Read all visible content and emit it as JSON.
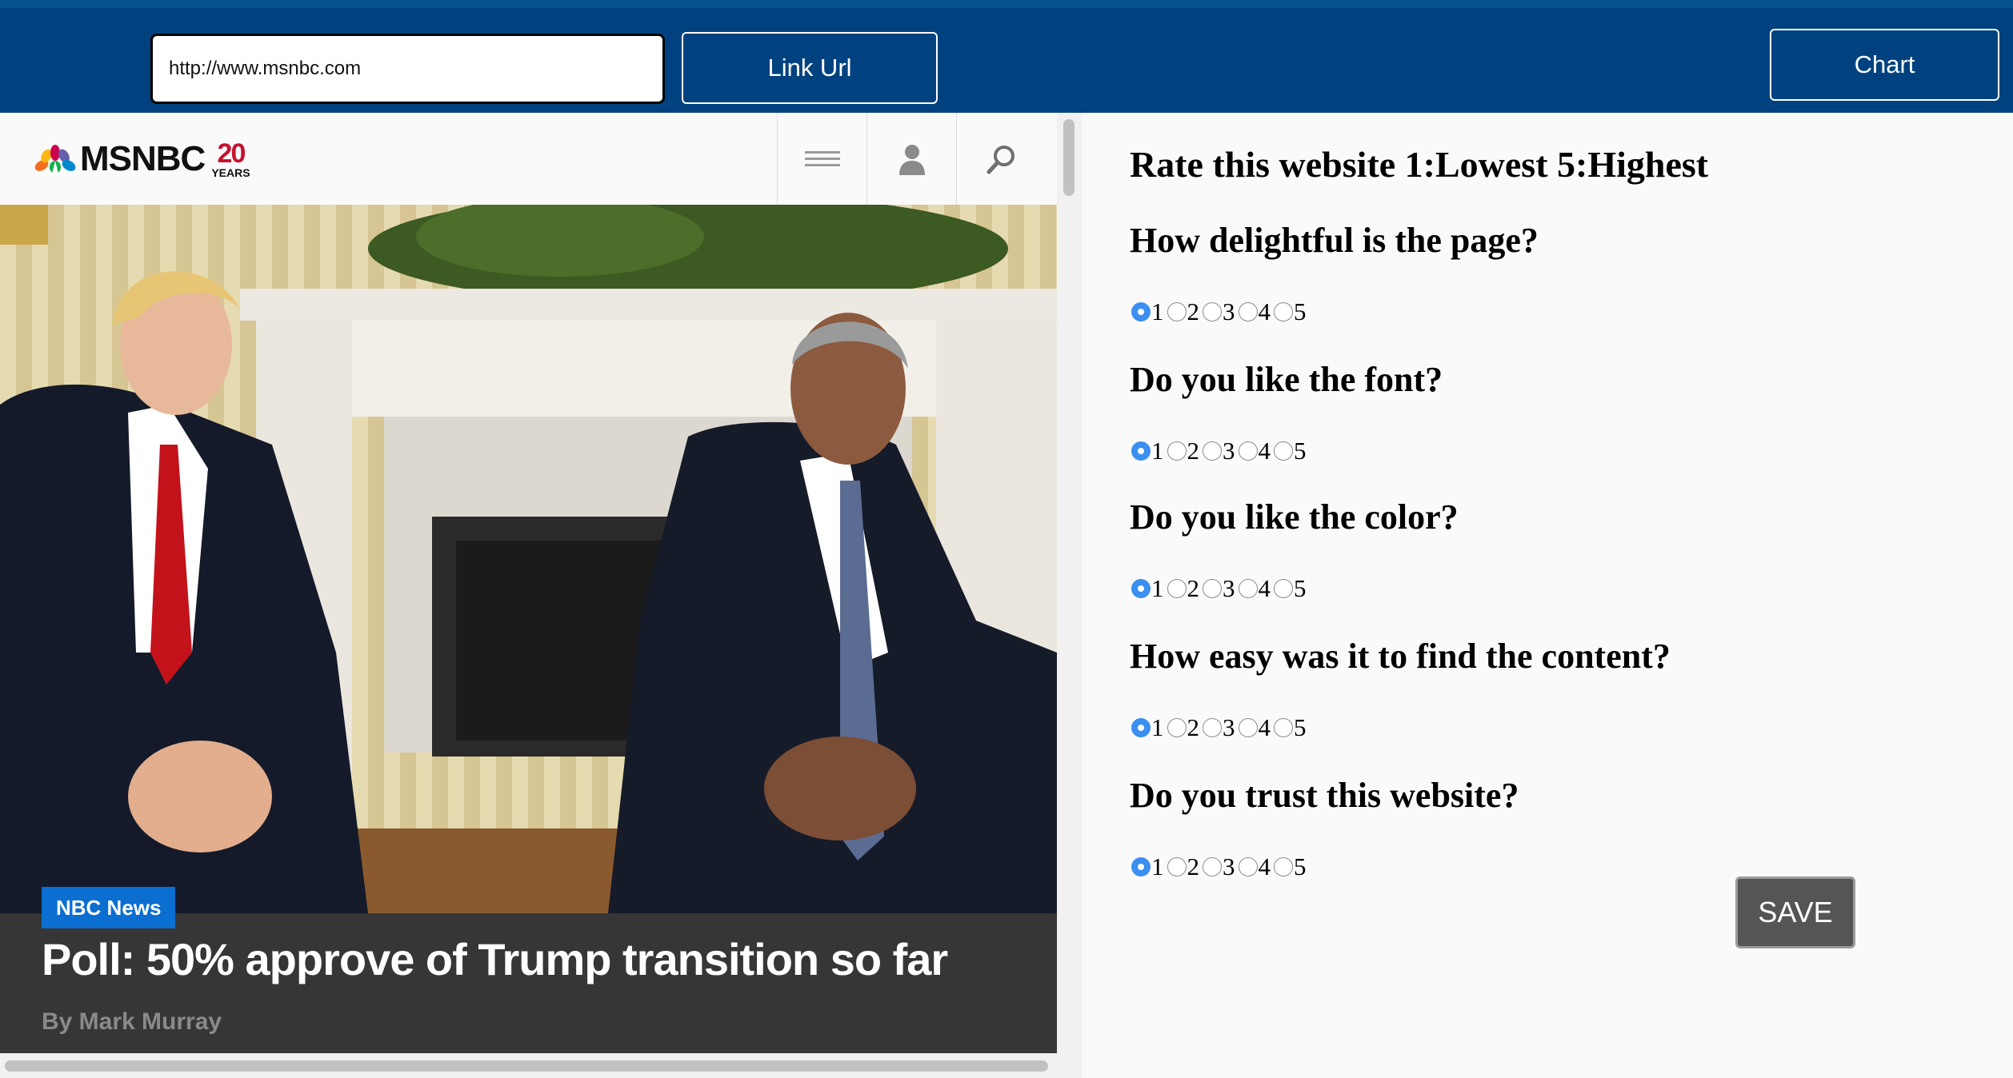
{
  "toolbar": {
    "url_value": "http://www.msnbc.com",
    "link_button": "Link Url",
    "chart_button": "Chart"
  },
  "site": {
    "logo_text": "MSNBC",
    "logo_years_number": "20",
    "logo_years_label": "YEARS",
    "header_icons": [
      "menu-icon",
      "user-icon",
      "search-icon"
    ],
    "article": {
      "badge": "NBC News",
      "headline": "Poll: 50% approve of Trump transition so far",
      "byline": "By Mark Murray"
    }
  },
  "survey": {
    "title": "Rate this website 1:Lowest 5:Highest",
    "questions": [
      {
        "text": "How delightful is the page?",
        "options": [
          "1",
          "2",
          "3",
          "4",
          "5"
        ],
        "selected": "1"
      },
      {
        "text": "Do you like the font?",
        "options": [
          "1",
          "2",
          "3",
          "4",
          "5"
        ],
        "selected": "1"
      },
      {
        "text": "Do you like the color?",
        "options": [
          "1",
          "2",
          "3",
          "4",
          "5"
        ],
        "selected": "1"
      },
      {
        "text": "How easy was it to find the content?",
        "options": [
          "1",
          "2",
          "3",
          "4",
          "5"
        ],
        "selected": "1"
      },
      {
        "text": "Do you trust this website?",
        "options": [
          "1",
          "2",
          "3",
          "4",
          "5"
        ],
        "selected": "1"
      }
    ],
    "save_button": "SAVE"
  },
  "colors": {
    "topbar": "#00427f",
    "radio_selected": "#3b8ff0",
    "badge": "#0b6ed1",
    "logo_red": "#c8102e"
  }
}
